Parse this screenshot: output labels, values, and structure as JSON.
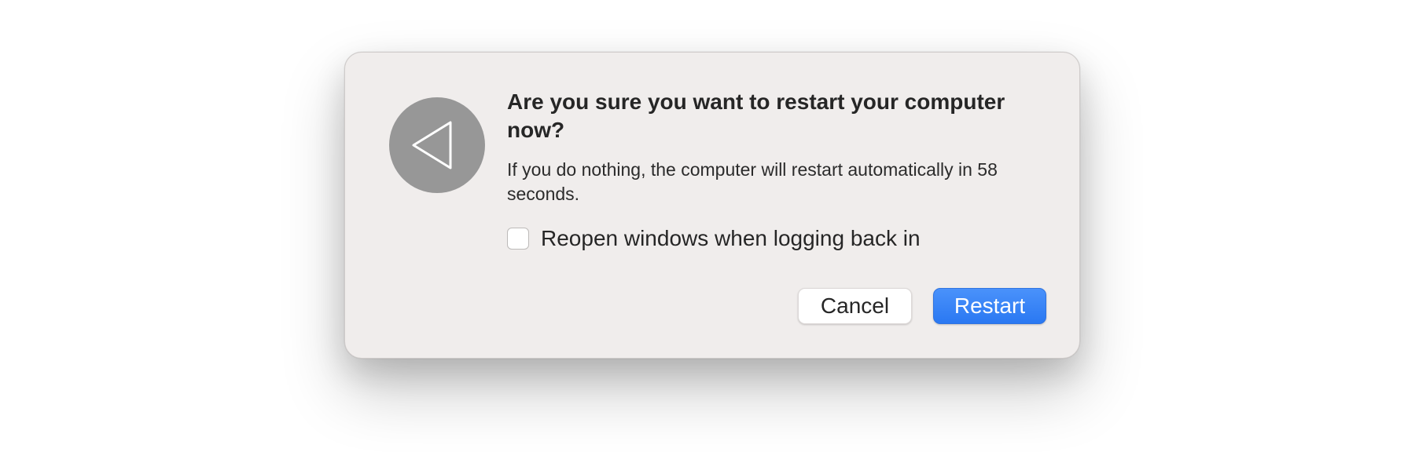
{
  "dialog": {
    "icon": "back-triangle-icon",
    "title": "Are you sure you want to restart your computer now?",
    "message": "If you do nothing, the computer will restart automatically in 58 seconds.",
    "checkbox": {
      "label": "Reopen windows when logging back in",
      "checked": false
    },
    "buttons": {
      "cancel_label": "Cancel",
      "restart_label": "Restart"
    }
  },
  "colors": {
    "dialog_background": "#f0edec",
    "icon_background": "#979797",
    "primary_button": "#2a78f2"
  }
}
